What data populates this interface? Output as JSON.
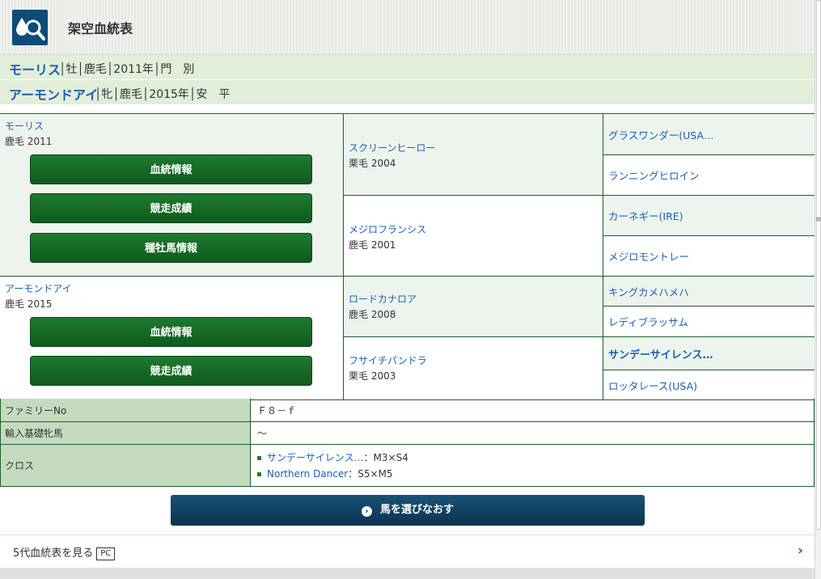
{
  "header": {
    "title": "架空血統表"
  },
  "sire_bar": {
    "name": "モーリス",
    "info": "│牡│鹿毛│2011年│門　別"
  },
  "dam_bar": {
    "name": "アーモンドアイ",
    "info": "│牝│鹿毛│2015年│安　平"
  },
  "pedigree": {
    "sire": {
      "name": "モーリス",
      "sub": "鹿毛 2011",
      "buttons": [
        "血統情報",
        "競走成績",
        "種牡馬情報"
      ]
    },
    "dam": {
      "name": "アーモンドアイ",
      "sub": "鹿毛 2015",
      "buttons": [
        "血統情報",
        "競走成績"
      ]
    },
    "gen2": [
      {
        "name": "スクリーンヒーロー",
        "sub": "栗毛 2004"
      },
      {
        "name": "メジロフランシス",
        "sub": "鹿毛 2001"
      },
      {
        "name": "ロードカナロア",
        "sub": "鹿毛 2008"
      },
      {
        "name": "フサイチパンドラ",
        "sub": "栗毛 2003"
      }
    ],
    "gen3": [
      {
        "name": "グラスワンダー(USA…"
      },
      {
        "name": "ランニングヒロイン"
      },
      {
        "name": "カーネギー(IRE)"
      },
      {
        "name": "メジロモントレー"
      },
      {
        "name": "キングカメハメハ"
      },
      {
        "name": "レディブラッサム"
      },
      {
        "name": "サンデーサイレンス…"
      },
      {
        "name": "ロッタレース(USA)"
      }
    ]
  },
  "info": {
    "family_label": "ファミリーNo",
    "family_value": "Ｆ８－ｆ",
    "import_label": "輸入基礎牝馬",
    "import_value": "～",
    "cross_label": "クロス",
    "crosses": [
      {
        "name": "サンデーサイレンス…",
        "value": "：M3×S4"
      },
      {
        "name": "Northern Dancer",
        "value": "：S5×M5"
      }
    ]
  },
  "reselect_label": "馬を選びなおす",
  "five_gen": {
    "label": "5代血統表を見る",
    "badge": "PC"
  },
  "colors": {
    "green": "#1c5e2d",
    "link": "#1a5fb4",
    "navy": "#0b3350",
    "label_bg": "#c5dbc0",
    "bar_bg": "#e2eed9"
  }
}
